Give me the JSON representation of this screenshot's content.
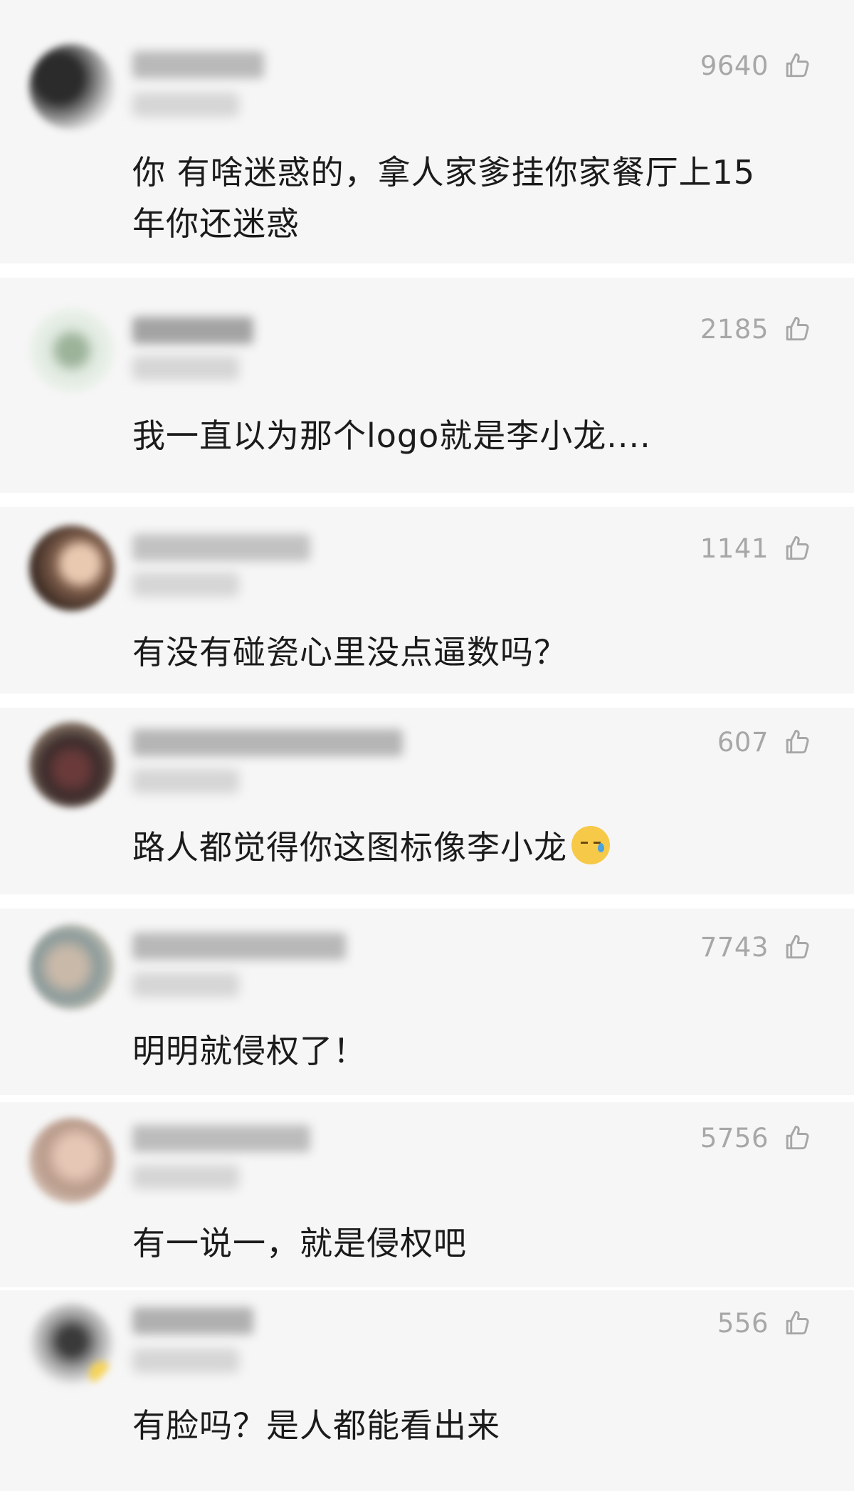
{
  "comments": [
    {
      "likes": "9640",
      "text_line1": "你 有啥迷惑的，拿人家爹挂你家餐厅上15",
      "text_line2": "年你还迷惑"
    },
    {
      "likes": "2185",
      "text_line1": "我一直以为那个logo就是李小龙...."
    },
    {
      "likes": "1141",
      "text_line1": "有没有碰瓷心里没点逼数吗？"
    },
    {
      "likes": "607",
      "text_line1": "路人都觉得你这图标像李小龙"
    },
    {
      "likes": "7743",
      "text_line1": "明明就侵权了！"
    },
    {
      "likes": "5756",
      "text_line1": "有一说一，就是侵权吧"
    },
    {
      "likes": "556",
      "text_line1": "有脸吗？是人都能看出来"
    }
  ],
  "icons": {
    "like": "thumbs-up-icon",
    "emoji": "sweat-emoji-icon"
  },
  "colors": {
    "text": "#1b1b1b",
    "meta": "#a7a7a7",
    "band": "#f6f6f6"
  }
}
